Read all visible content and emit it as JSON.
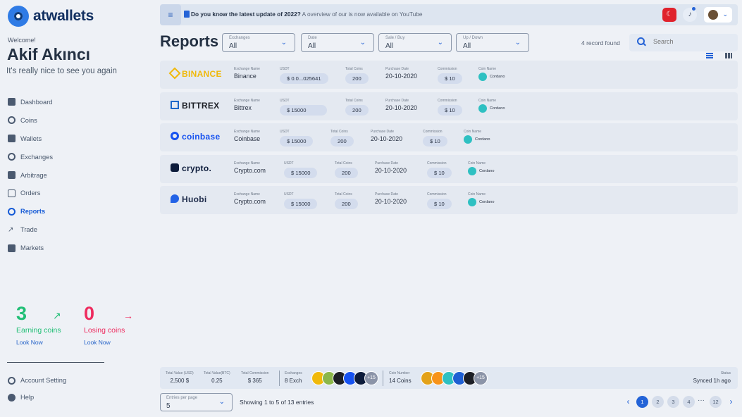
{
  "app": {
    "logo": "atwallets"
  },
  "welcome": {
    "label": "Welcome!",
    "name": "Akif Akıncı",
    "subtitle": "It's really nice to see you again"
  },
  "menu": [
    {
      "label": "Dashboard",
      "icon": "dashboard-icon"
    },
    {
      "label": "Coins",
      "icon": "coins-icon"
    },
    {
      "label": "Wallets",
      "icon": "wallet-icon"
    },
    {
      "label": "Exchanges",
      "icon": "exchanges-icon"
    },
    {
      "label": "Arbitrage",
      "icon": "arbitrage-icon"
    },
    {
      "label": "Orders",
      "icon": "orders-icon"
    },
    {
      "label": "Reports",
      "icon": "reports-icon"
    },
    {
      "label": "Trade",
      "icon": "trade-icon"
    },
    {
      "label": "Markets",
      "icon": "markets-icon"
    }
  ],
  "stats": {
    "earning": {
      "number": "3",
      "label": "Earning coins",
      "link": "Look Now",
      "color": "#21bf76"
    },
    "losing": {
      "number": "0",
      "label": "Losing coins",
      "link": "Look Now",
      "color": "#ee2c5f"
    }
  },
  "bottom_menu": [
    {
      "label": "Account Setting",
      "icon": "account-setting-icon"
    },
    {
      "label": "Help",
      "icon": "help-icon"
    }
  ],
  "topbar": {
    "notice_bold": "Do you know the latest update of 2022?",
    "notice_rest": " A overview of our is now available on YouTube",
    "flag": "turkey-flag",
    "notifications": "bell-icon"
  },
  "page": {
    "title": "Reports",
    "record_count": "4 record found"
  },
  "filters": [
    {
      "label": "Exchanges",
      "value": "All"
    },
    {
      "label": "Date",
      "value": "All"
    },
    {
      "label": "Sale / Buy",
      "value": "All"
    },
    {
      "label": "Up / Down",
      "value": "All"
    }
  ],
  "search": {
    "placeholder": "Search"
  },
  "field_labels": {
    "exchange": "Exchange Name",
    "usdt": "USDT",
    "total": "Total Coins",
    "date": "Purchase Date",
    "commission": "Commission",
    "coin": "Coin Name"
  },
  "rows": [
    {
      "brand": "BINANCE",
      "brand_color": "#f0b90b",
      "exchange": "Binance",
      "usdt": "$ 0.0...025641",
      "total": "200",
      "date": "20-10-2020",
      "commission": "$ 10",
      "coin": "Cordano"
    },
    {
      "brand": "BITTREX",
      "brand_color": "#1c1f26",
      "exchange": "Bittrex",
      "usdt": "$ 15000",
      "total": "200",
      "date": "20-10-2020",
      "commission": "$ 10",
      "coin": "Cordano"
    },
    {
      "brand": "coinbase",
      "brand_color": "#1652f0",
      "exchange": "Coinbase",
      "usdt": "$ 15000",
      "total": "200",
      "date": "20-10-2020",
      "commission": "$ 10",
      "coin": "Cordano"
    },
    {
      "brand": "crypto.",
      "brand_color": "#0d1c3b",
      "exchange": "Crypto.com",
      "usdt": "$ 15000",
      "total": "200",
      "date": "20-10-2020",
      "commission": "$ 10",
      "coin": "Cordano"
    },
    {
      "brand": "Huobi",
      "brand_color": "#1e2b4a",
      "exchange": "Crypto.com",
      "usdt": "$ 15000",
      "total": "200",
      "date": "20-10-2020",
      "commission": "$ 10",
      "coin": "Cordano"
    }
  ],
  "summary": {
    "total_usd_label": "Total Value (USD)",
    "total_usd": "2,500 $",
    "total_btc_label": "Total Value(BTC)",
    "total_btc": "0.25",
    "commission_label": "Total Commission",
    "commission": "$ 365",
    "exchanges_label": "Exchanges",
    "exchanges": "8 Exch",
    "exchanges_more": "+15",
    "coins_label": "Coin Number",
    "coins": "14 Coins",
    "coins_more": "+15",
    "status_label": "Status",
    "status": "Synced 1h ago"
  },
  "pagination": {
    "per_page_label": "Entries per page",
    "per_page": "5",
    "showing": "Showing 1 to 5 of 13 entries",
    "pages": [
      "1",
      "2",
      "3",
      "4"
    ],
    "ellipsis": "···",
    "last": "12"
  }
}
